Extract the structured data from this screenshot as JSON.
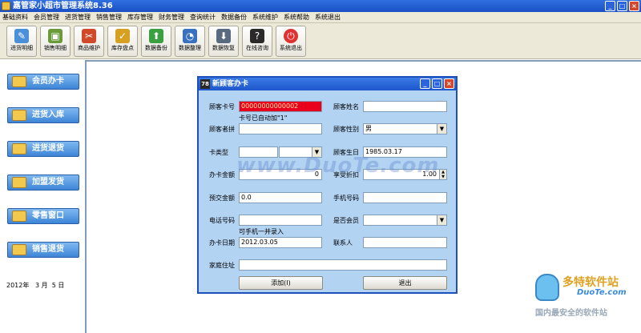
{
  "app": {
    "title": "嘉管家小超市管理系统8.36",
    "win_buttons": [
      "_",
      "□",
      "×"
    ]
  },
  "menu": [
    "基础资料",
    "会员管理",
    "进货管理",
    "销售管理",
    "库存管理",
    "财务管理",
    "查询统计",
    "数据备份",
    "系统维护",
    "系统帮助",
    "系统退出"
  ],
  "toolbar": [
    {
      "label": "进货明细",
      "icon": "brush-icon",
      "color": "#4a90d9"
    },
    {
      "label": "销售明细",
      "icon": "box-icon",
      "color": "#6a9a3a"
    },
    {
      "label": "商品维护",
      "icon": "tools-icon",
      "color": "#d04a2a"
    },
    {
      "label": "库存盘点",
      "icon": "clipboard-icon",
      "color": "#d8a020"
    },
    {
      "label": "数据备份",
      "icon": "backup-icon",
      "color": "#3aa040"
    },
    {
      "label": "数据整理",
      "icon": "chart-icon",
      "color": "#3a70c0"
    },
    {
      "label": "数据恢复",
      "icon": "restore-icon",
      "color": "#5a6a80"
    },
    {
      "label": "在线咨询",
      "icon": "help-icon",
      "color": "#2a2a2a"
    },
    {
      "label": "系统退出",
      "icon": "power-icon",
      "color": "#e03030"
    }
  ],
  "sidebar": {
    "items": [
      "会员办卡",
      "进货入库",
      "进货退货",
      "加盟发货",
      "零售窗口",
      "销售退货"
    ],
    "date": "2012年   3 月  5 日"
  },
  "dialog": {
    "title": "新顾客办卡",
    "icon_text": "78",
    "labels": {
      "card_no": "顾客卡号",
      "name": "顾客姓名",
      "pinyin": "顾客者拼",
      "gender": "顾客性别",
      "card_type": "卡类型",
      "birthday": "顾客生日",
      "fee": "办卡金额",
      "discount": "享受折扣",
      "prepay": "预交金额",
      "mobile": "手机号码",
      "phone": "电话号码",
      "member": "是否会员",
      "open_date": "办卡日期",
      "contact": "联系人",
      "address": "家庭住址"
    },
    "values": {
      "card_no": "00000000000002",
      "name": "",
      "pinyin": "",
      "gender": "男",
      "card_type_1": "",
      "card_type_2": "",
      "birthday": "1985.03.17",
      "fee": "0",
      "discount": "1.00",
      "prepay": "0.0",
      "mobile": "",
      "phone": "",
      "member": "",
      "open_date": "2012.03.05",
      "contact": "",
      "address": ""
    },
    "hints": {
      "card_no": "卡号已自动加\"1\"",
      "phone": "可手机一并录入"
    },
    "buttons": {
      "add": "添加(I)",
      "exit": "退出"
    }
  },
  "watermarks": {
    "center": "www.DuoTe.com",
    "corner_big": "多特软件站",
    "corner_url": "DuoTe.com",
    "corner_sub": "国内最安全的软件站"
  }
}
